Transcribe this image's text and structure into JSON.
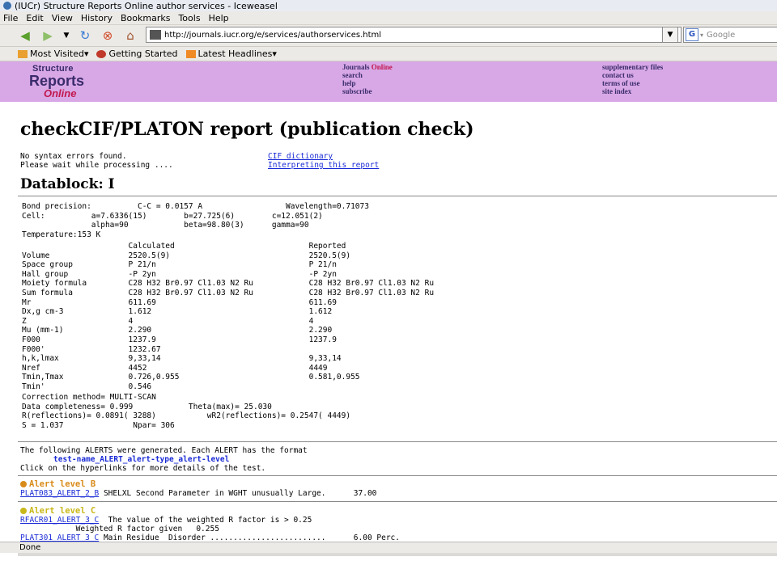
{
  "window": {
    "title": "(IUCr) Structure Reports Online author services - Iceweasel"
  },
  "menu": [
    "File",
    "Edit",
    "View",
    "History",
    "Bookmarks",
    "Tools",
    "Help"
  ],
  "toolbar": {
    "url": "http://journals.iucr.org/e/services/authorservices.html",
    "search_placeholder": "Google"
  },
  "bookmarks": [
    "Most Visited▾",
    "Getting Started",
    "Latest Headlines▾"
  ],
  "banner": {
    "logo_line1": "Structure",
    "logo_line2": "Reports",
    "logo_line3": "Online",
    "col1": [
      "Journals ",
      "search",
      "help",
      "subscribe"
    ],
    "col1_online": "Online",
    "col2": [
      "supplementary files",
      "contact us",
      "terms of use",
      "site index"
    ]
  },
  "report": {
    "title": "checkCIF/PLATON report (publication check)",
    "status1": "No syntax errors found.",
    "status2": "Please wait while processing ....",
    "link_cif": "CIF dictionary",
    "link_interp": "Interpreting this report",
    "datablock": "Datablock: I",
    "block1": "Bond precision:          C-C = 0.0157 A                  Wavelength=0.71073\nCell:          a=7.6336(15)        b=27.725(6)        c=12.051(2)\n               alpha=90            beta=98.80(3)      gamma=90\nTemperature:153 K",
    "table": "                       Calculated                             Reported\nVolume                 2520.5(9)                              2520.5(9)\nSpace group            P 21/n                                 P 21/n\nHall group             -P 2yn                                 -P 2yn\nMoiety formula         C28 H32 Br0.97 Cl1.03 N2 Ru            C28 H32 Br0.97 Cl1.03 N2 Ru\nSum formula            C28 H32 Br0.97 Cl1.03 N2 Ru            C28 H32 Br0.97 Cl1.03 N2 Ru\nMr                     611.69                                 611.69\nDx,g cm-3              1.612                                  1.612\nZ                      4                                      4\nMu (mm-1)              2.290                                  2.290\nF000                   1237.9                                 1237.9\nF000'                  1232.67\nh,k,lmax               9,33,14                                9,33,14\nNref                   4452                                   4449\nTmin,Tmax              0.726,0.955                            0.581,0.955\nTmin'                  0.546",
    "block3": "Correction method= MULTI-SCAN\nData completeness= 0.999            Theta(max)= 25.030\nR(reflections)= 0.0891( 3288)           wR2(reflections)= 0.2547( 4449)\nS = 1.037               Npar= 306",
    "alerts_intro1": "The following ALERTS were generated. Each ALERT has the format",
    "alerts_format": "test-name_ALERT_alert-type_alert-level",
    "alerts_intro3": "Click on the hyperlinks for more details of the test.",
    "level_b": "Alert level B",
    "b1_link": "PLAT083_ALERT_2_B",
    "b1_text": " SHELXL Second Parameter in WGHT unusually Large.      37.00",
    "level_c": "Alert level C",
    "c1_link": "RFACR01_ALERT_3_C",
    "c1_text": "  The value of the weighted R factor is > 0.25",
    "c1_detail": "            Weighted R factor given   0.255",
    "c2_link": "PLAT301_ALERT_3_C",
    "c2_text": " Main Residue  Disorder .........................      6.00 Perc."
  },
  "statusbar": {
    "text": "Done"
  },
  "colors": {
    "banner": "#d8a8e6",
    "link": "#1a2bd6",
    "alert_b": "#d98b1a",
    "alert_c": "#c9b81a"
  }
}
